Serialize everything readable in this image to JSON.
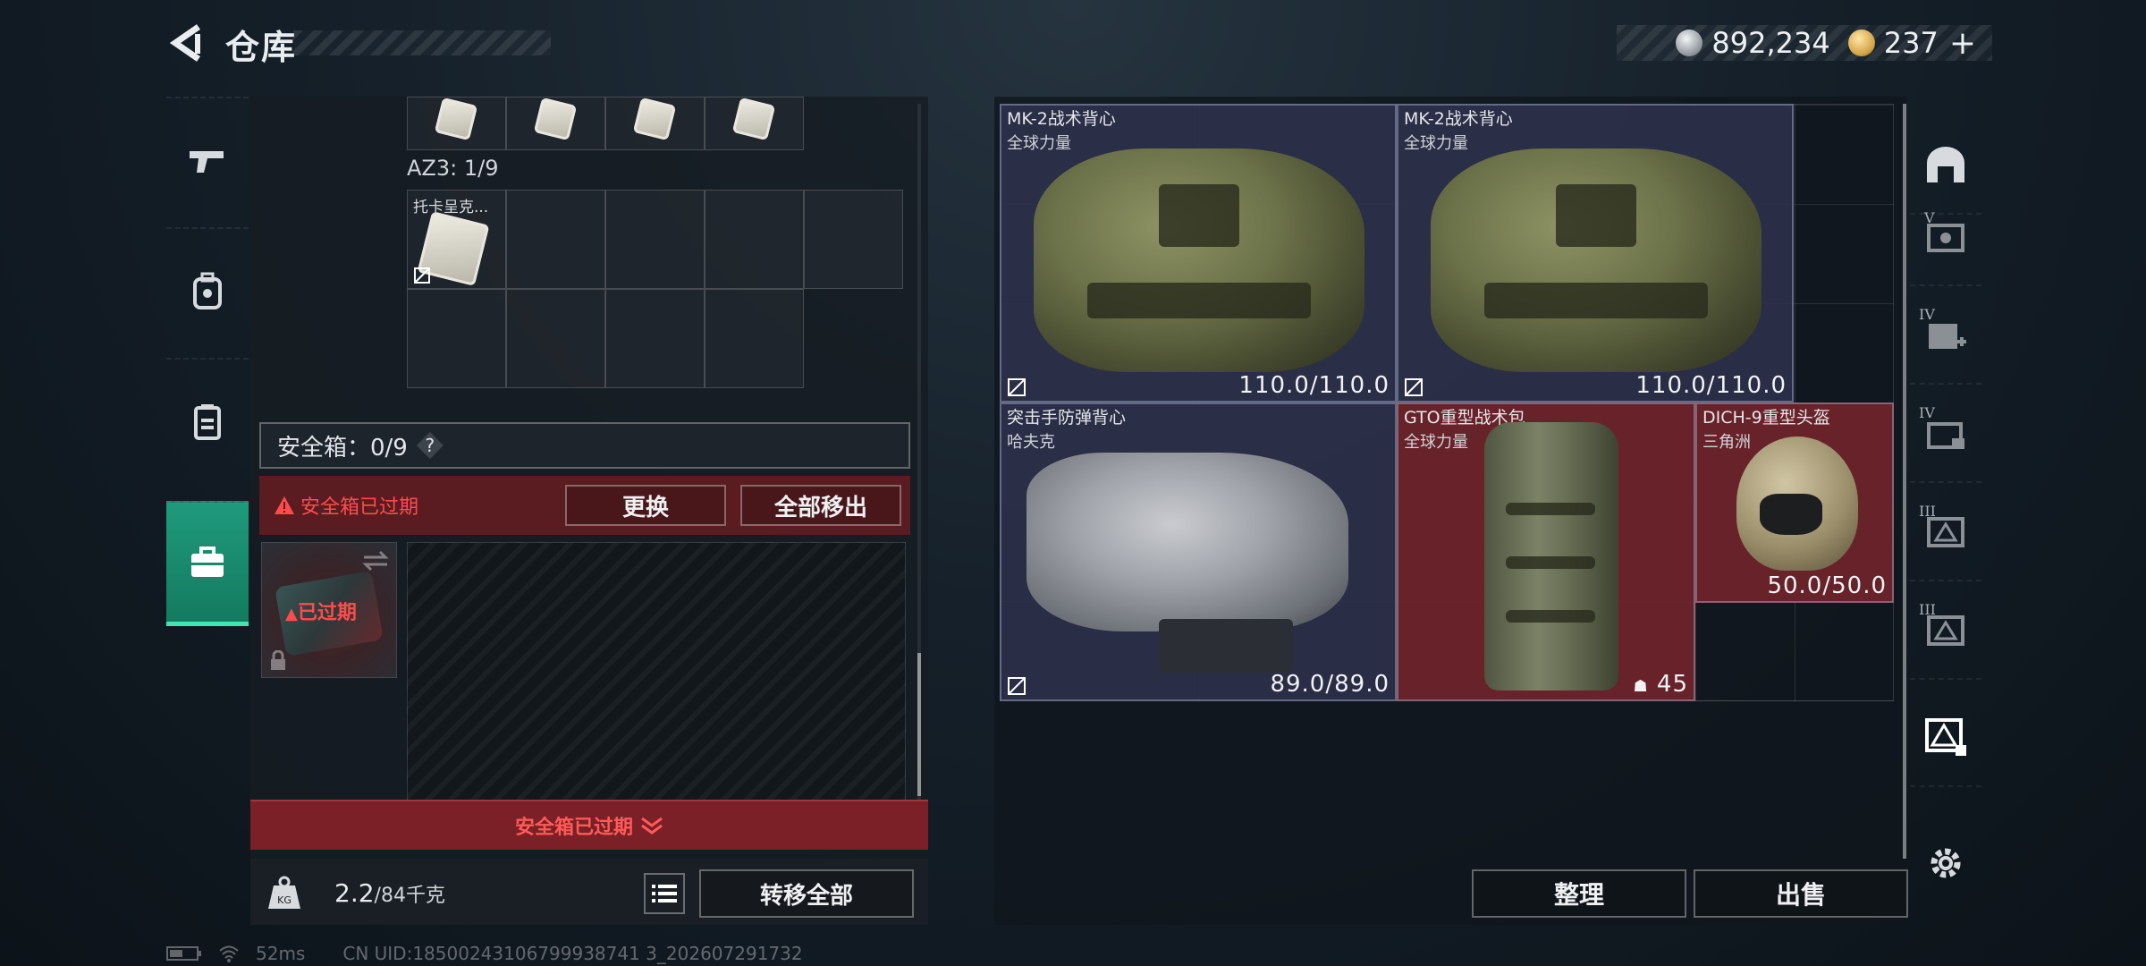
{
  "header": {
    "title": "仓库"
  },
  "currency": {
    "silver": "892,234",
    "gold": "237",
    "add_symbol": "+"
  },
  "left": {
    "az3_label": "AZ3: 1/9",
    "item_label": "托卡呈克...",
    "safe_box_label": "安全箱：0/9",
    "help_symbol": "?",
    "expired_warning": "安全箱已过期",
    "replace_button": "更换",
    "remove_all_button": "全部移出",
    "case_overlay": "已过期",
    "expired_footer": "安全箱已过期",
    "weight_current": "2.2",
    "weight_max": "/84千克",
    "transfer_all_button": "转移全部"
  },
  "stash": {
    "items": [
      {
        "name": "MK-2战术背心",
        "brand": "全球力量",
        "durability": "110.0/110.0"
      },
      {
        "name": "MK-2战术背心",
        "brand": "全球力量",
        "durability": "110.0/110.0"
      },
      {
        "name": "突击手防弹背心",
        "brand": "哈夫克",
        "durability": "89.0/89.0"
      },
      {
        "name": "GTO重型战术包",
        "brand": "全球力量",
        "capacity": "45"
      },
      {
        "name": "DICH-9重型头盔",
        "brand": "三角洲",
        "durability": "50.0/50.0"
      }
    ],
    "sort_button": "整理",
    "sell_button": "出售"
  },
  "rail_labels": {
    "t1": "V",
    "t2": "IV",
    "t3": "IV",
    "t4": "III",
    "t5": "III"
  },
  "status": {
    "ping": "52ms",
    "uid": "CN UID:18500243106799938741 3_202607291732"
  },
  "colors": {
    "accent": "#1f9a7c",
    "warning": "#ff4b4b",
    "expired_bg": "#7a2026"
  }
}
